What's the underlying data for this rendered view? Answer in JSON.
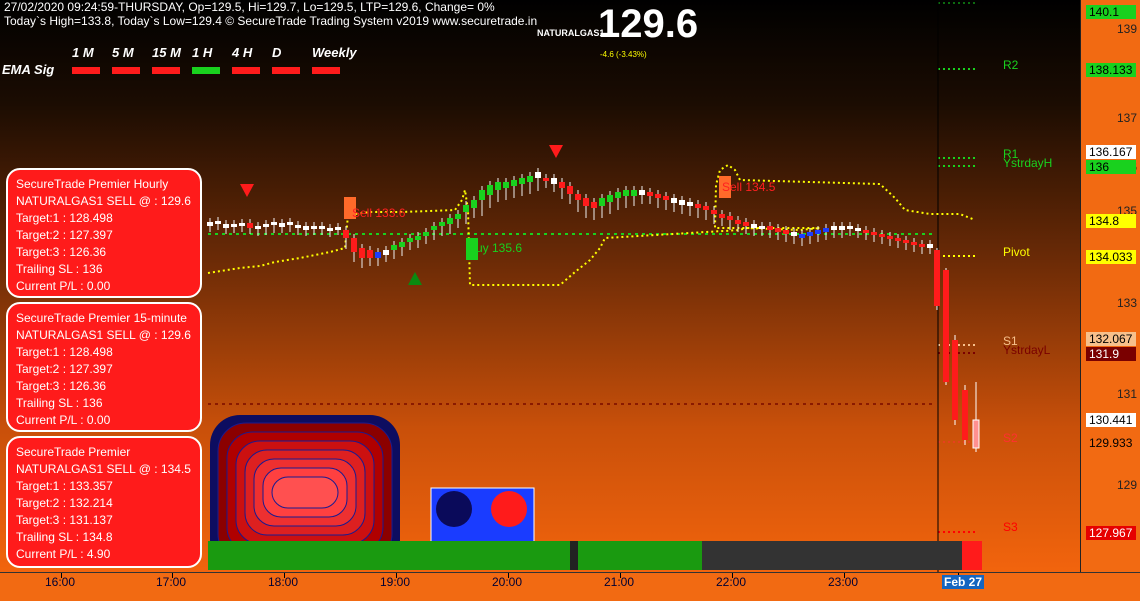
{
  "header": {
    "line1": "27/02/2020 09:24:59-THURSDAY, Op=129.5, Hi=129.7, Lo=129.5, LTP=129.6, Change= 0%",
    "line2": "Today`s High=133.8, Today`s Low=129.4 © SecureTrade Trading System v2019 www.securetrade.in",
    "symbol": "NATURALGAS1",
    "ltp": "129.6",
    "change": "-4.6 (-3.43%)"
  },
  "ema": {
    "label": "EMA Sig",
    "timeframes": [
      {
        "label": "1 M",
        "color": "#ff1b1b"
      },
      {
        "label": "5 M",
        "color": "#ff1b1b"
      },
      {
        "label": "15 M",
        "color": "#ff1b1b"
      },
      {
        "label": "1 H",
        "color": "#19d11e"
      },
      {
        "label": "4 H",
        "color": "#ff1b1b"
      },
      {
        "label": "D",
        "color": "#ff1b1b"
      },
      {
        "label": "Weekly",
        "color": "#ff1b1b"
      }
    ]
  },
  "boxes": [
    {
      "lines": [
        "SecureTrade Premier Hourly",
        "NATURALGAS1 SELL @  : 129.6",
        "Target:1 : 128.498",
        "Target:2 : 127.397",
        "Target:3 : 126.36",
        "Trailing SL : 136",
        "Current P/L : 0.00"
      ]
    },
    {
      "lines": [
        "SecureTrade Premier 15-minute",
        "NATURALGAS1 SELL @  : 129.6",
        "Target:1 : 128.498",
        "Target:2 : 127.397",
        "Target:3 : 126.36",
        "Trailing SL : 136",
        "Current P/L : 0.00"
      ]
    },
    {
      "lines": [
        "SecureTrade Premier",
        "NATURALGAS1 SELL @  : 134.5",
        "Target:1 : 133.357",
        "Target:2 : 132.214",
        "Target:3 : 131.137",
        "Trailing SL : 134.8",
        "Current P/L : 4.90"
      ]
    }
  ],
  "levels": {
    "r2": "R2",
    "r1": "R1",
    "ystrdayh": "YstrdayH",
    "pivot": "Pivot",
    "s1": "S1",
    "ystrdayl": "YstrdayL",
    "s2": "S2",
    "s3": "S3"
  },
  "signals": {
    "sell1": "Sell 133.6",
    "buy1": "Buy 135.6",
    "sell2": "Sell 134.5"
  },
  "price_scale": {
    "ticks": [
      "139",
      "137",
      "136",
      "135",
      "133",
      "131",
      "129"
    ],
    "boxes": [
      {
        "text": "140.1",
        "bg": "#19d11e",
        "fg": "#000"
      },
      {
        "text": "138.133",
        "bg": "#19d11e",
        "fg": "#000"
      },
      {
        "text": "136.167",
        "bg": "#ffffff",
        "fg": "#000"
      },
      {
        "text": "136",
        "bg": "#19d11e",
        "fg": "#000"
      },
      {
        "text": "134.8",
        "bg": "#ffff00",
        "fg": "#000"
      },
      {
        "text": "134.033",
        "bg": "#ffff00",
        "fg": "#000"
      },
      {
        "text": "132.067",
        "bg": "#f7c08c",
        "fg": "#000"
      },
      {
        "text": "131.9",
        "bg": "#7a0000",
        "fg": "#fff"
      },
      {
        "text": "130.441",
        "bg": "#ffffff",
        "fg": "#000"
      },
      {
        "text": "129.933",
        "bg": "#f26a12",
        "fg": "#000"
      },
      {
        "text": "127.967",
        "bg": "#e60000",
        "fg": "#fff"
      }
    ]
  },
  "time_axis": [
    "16:00",
    "17:00",
    "18:00",
    "19:00",
    "20:00",
    "21:00",
    "22:00",
    "23:00",
    "Feb 27"
  ],
  "colors": {
    "up": "#19d11e",
    "down": "#ff1b1b",
    "dotted": "#ffff00"
  }
}
